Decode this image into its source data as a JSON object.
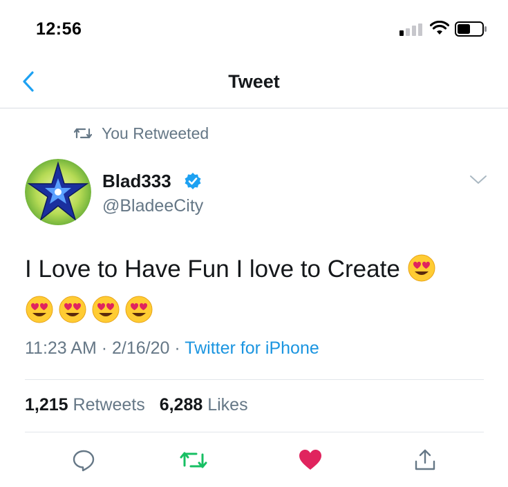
{
  "status_bar": {
    "time": "12:56"
  },
  "nav": {
    "title": "Tweet"
  },
  "retweet_context": {
    "label": "You Retweeted"
  },
  "author": {
    "display_name": "Blad333",
    "handle": "@BladeeCity",
    "verified": true
  },
  "tweet": {
    "text": "I Love to Have Fun I love to Create",
    "emoji": [
      "smiling-face-with-heart-eyes",
      "smiling-face-with-heart-eyes",
      "smiling-face-with-heart-eyes",
      "smiling-face-with-heart-eyes",
      "smiling-face-with-heart-eyes"
    ]
  },
  "meta": {
    "time": "11:23 AM",
    "date": "2/16/20",
    "separator": "·",
    "source": "Twitter for iPhone"
  },
  "stats": {
    "retweets_count": "1,215",
    "retweets_label": "Retweets",
    "likes_count": "6,288",
    "likes_label": "Likes"
  },
  "actions": [
    {
      "name": "reply",
      "icon": "reply-icon",
      "state": "inactive"
    },
    {
      "name": "retweet",
      "icon": "retweet-icon",
      "state": "active"
    },
    {
      "name": "like",
      "icon": "heart-icon",
      "state": "active"
    },
    {
      "name": "share",
      "icon": "share-icon",
      "state": "inactive"
    }
  ],
  "colors": {
    "accent": "#1da1f2",
    "link": "#1b95e0",
    "secondary_text": "#657786",
    "retweet_active": "#17bf63",
    "like_active": "#e0245e"
  }
}
